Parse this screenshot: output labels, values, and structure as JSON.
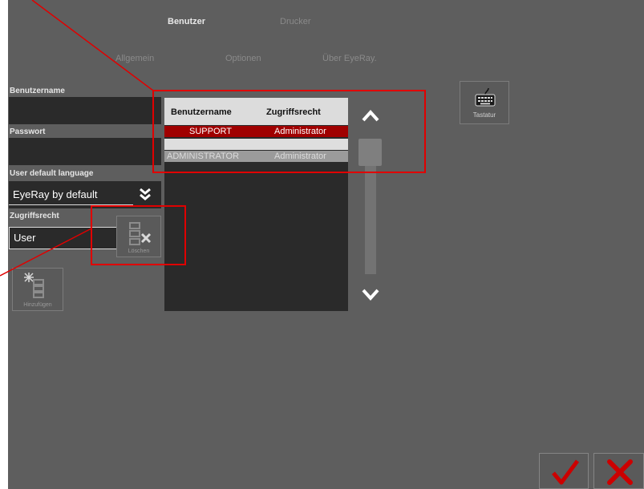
{
  "tabs_top": [
    {
      "label": "Benutzer",
      "active": true
    },
    {
      "label": "Drucker",
      "active": false
    }
  ],
  "tabs_sub": [
    {
      "label": "Allgemein"
    },
    {
      "label": "Optionen"
    },
    {
      "label": "Über EyeRay."
    }
  ],
  "form": {
    "username_label": "Benutzername",
    "password_label": "Passwort",
    "language_label": "User default language",
    "language_value": "EyeRay by default",
    "access_label": "Zugriffsrecht",
    "access_value": "User"
  },
  "buttons": {
    "keyboard_label": "Tastatur",
    "delete_label": "Löschen",
    "add_label": "Hinzufügen"
  },
  "table": {
    "headers": [
      "Benutzername",
      "Zugriffsrecht"
    ],
    "rows": [
      {
        "user": "SUPPORT",
        "right": "Administrator"
      },
      {
        "user": "",
        "right": ""
      },
      {
        "user": "ADMINISTRATOR",
        "right": "Administrator"
      }
    ]
  },
  "colors": {
    "background": "#5e5e5e",
    "selected_row": "#a00000",
    "annotation": "#e00000",
    "confirm": "#cc0000"
  }
}
